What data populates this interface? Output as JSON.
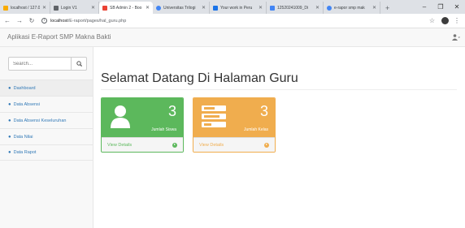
{
  "browser": {
    "tabs": [
      {
        "title": "localhost / 127.0.0",
        "color": "#f9ab00",
        "active": false
      },
      {
        "title": "Login V1",
        "color": "#5f6368",
        "active": false
      },
      {
        "title": "SB Admin 2 - Boo",
        "color": "#ea4335",
        "active": true
      },
      {
        "title": "Universitas Trilogi",
        "color": "#4285f4",
        "active": false
      },
      {
        "title": "Your work in Peru",
        "color": "#1a73e8",
        "active": false
      },
      {
        "title": "12520241009_Di",
        "color": "#4285f4",
        "active": false
      },
      {
        "title": "e-rapor smp mak",
        "color": "#4285f4",
        "active": false
      }
    ],
    "url_host": "localhost",
    "url_path": "/E-raport/pages/hal_guru.php"
  },
  "navbar": {
    "brand": "Aplikasi E-Raport SMP Makna Bakti"
  },
  "sidebar": {
    "search_placeholder": "Search...",
    "items": [
      {
        "label": "Dashboard",
        "active": true
      },
      {
        "label": "Data Absensi",
        "active": false
      },
      {
        "label": "Data Absensi Keseluruhan",
        "active": false
      },
      {
        "label": "Data Nilai",
        "active": false
      },
      {
        "label": "Data Rapot",
        "active": false
      }
    ]
  },
  "main": {
    "title": "Selamat Datang Di Halaman Guru",
    "panels": [
      {
        "count": "3",
        "label": "Jumlah Siswa",
        "footer": "View Details",
        "color": "#5cb85c",
        "icon": "user-icon"
      },
      {
        "count": "3",
        "label": "Jumlah Kelas",
        "footer": "View Details",
        "color": "#f0ad4e",
        "icon": "tasks-icon"
      }
    ]
  }
}
